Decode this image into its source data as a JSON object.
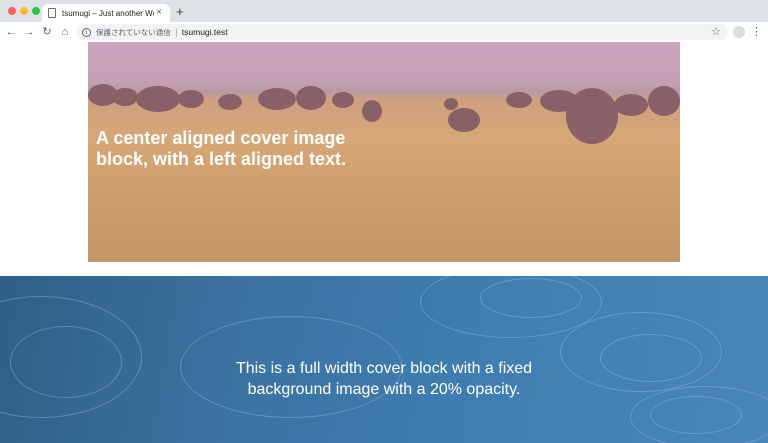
{
  "browser": {
    "tab_title": "tsumugi – Just another WordP",
    "tab_close": "×",
    "new_tab": "+",
    "nav": {
      "back": "←",
      "forward": "→",
      "reload": "↻",
      "home": "⌂"
    },
    "info_icon": "i",
    "security_text": "保護されていない通信",
    "url": "tsumugi.test",
    "bookmark_star": "☆",
    "menu": "⋮"
  },
  "cover_center": {
    "heading": "A center aligned cover image block, with a left aligned text.",
    "overlay_color": "#c9a3bd"
  },
  "cover_full": {
    "text": "This is a full width cover block with a fixed background image with a 20% opacity.",
    "overlay_color": "#3f7db0"
  }
}
